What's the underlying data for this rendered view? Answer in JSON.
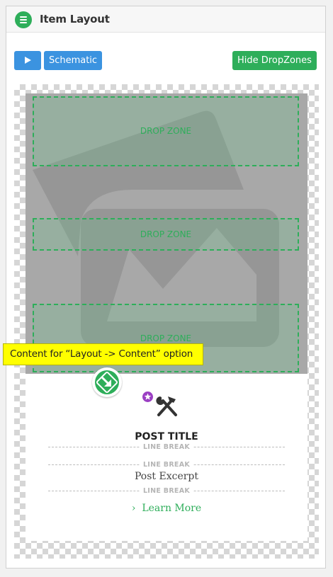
{
  "header": {
    "title": "Item Layout"
  },
  "toolbar": {
    "schematic_label": "Schematic",
    "hide_dropzones_label": "Hide DropZones"
  },
  "dropzones": [
    "DROP ZONE",
    "DROP ZONE",
    "DROP ZONE"
  ],
  "tooltip": {
    "text": "Content for “Layout -> Content” option"
  },
  "content": {
    "post_title": "POST TITLE",
    "line_break_label": "LINE BREAK",
    "post_excerpt": "Post Excerpt",
    "learn_more": "Learn More",
    "learn_more_chevron": "›"
  },
  "colors": {
    "accent_green": "#2eae5a",
    "accent_blue": "#3b93e0",
    "badge_purple": "#9b3fc3",
    "tooltip_yellow": "#ffff00"
  },
  "icons": [
    "menu-icon",
    "play-icon",
    "image-placeholder-icon",
    "move-arrow-icon",
    "star-icon",
    "tools-icon",
    "chevron-right-icon"
  ]
}
